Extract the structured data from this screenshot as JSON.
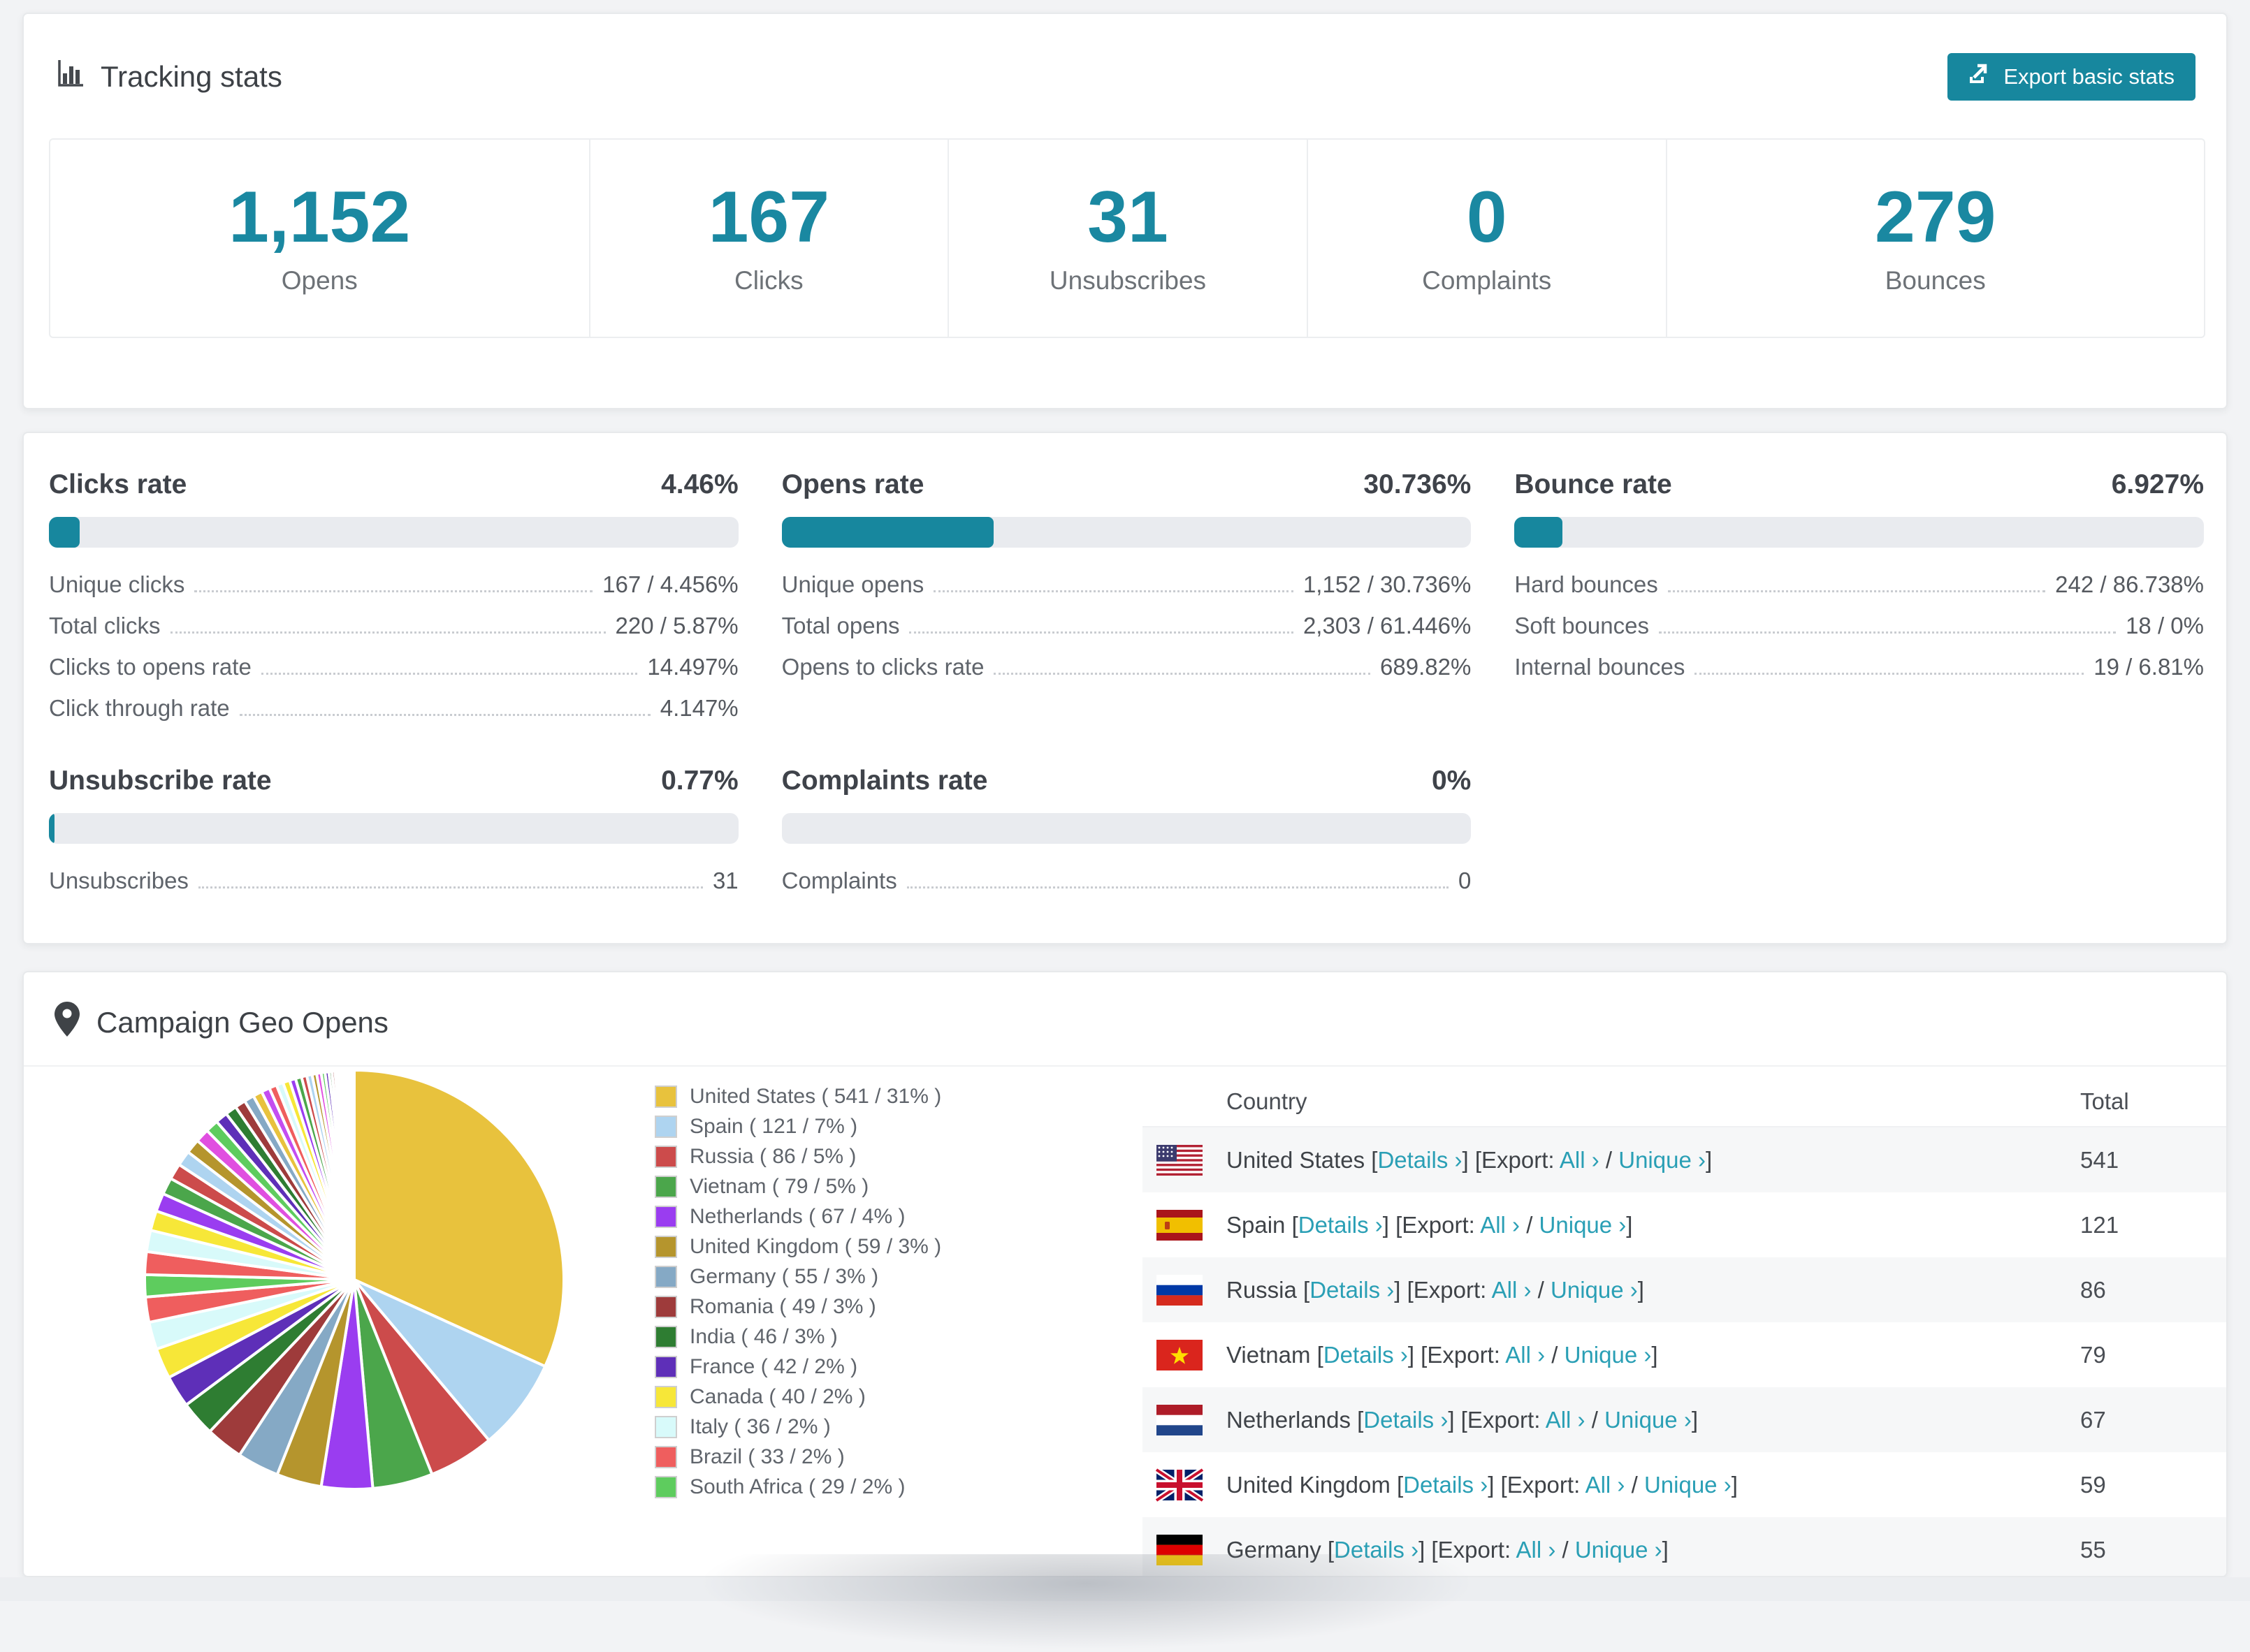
{
  "colors": {
    "accent": "#17879e",
    "stat_number": "#1a88a1",
    "link": "#2a9fb5",
    "bar_track": "#e9ebef",
    "stripe": "#f6f7f8"
  },
  "tracking": {
    "title": "Tracking stats",
    "export_label": "Export basic stats",
    "stats": [
      {
        "value": "1,152",
        "label": "Opens"
      },
      {
        "value": "167",
        "label": "Clicks"
      },
      {
        "value": "31",
        "label": "Unsubscribes"
      },
      {
        "value": "0",
        "label": "Complaints"
      },
      {
        "value": "279",
        "label": "Bounces"
      }
    ]
  },
  "rates": [
    {
      "title": "Clicks rate",
      "value": "4.46%",
      "pct": 4.46,
      "rows": [
        {
          "label": "Unique clicks",
          "value": "167 / 4.456%"
        },
        {
          "label": "Total clicks",
          "value": "220 / 5.87%"
        },
        {
          "label": "Clicks to opens rate",
          "value": "14.497%"
        },
        {
          "label": "Click through rate",
          "value": "4.147%"
        }
      ]
    },
    {
      "title": "Opens rate",
      "value": "30.736%",
      "pct": 30.736,
      "rows": [
        {
          "label": "Unique opens",
          "value": "1,152 / 30.736%"
        },
        {
          "label": "Total opens",
          "value": "2,303 / 61.446%"
        },
        {
          "label": "Opens to clicks rate",
          "value": "689.82%"
        }
      ]
    },
    {
      "title": "Bounce rate",
      "value": "6.927%",
      "pct": 6.927,
      "rows": [
        {
          "label": "Hard bounces",
          "value": "242 / 86.738%"
        },
        {
          "label": "Soft bounces",
          "value": "18 / 0%"
        },
        {
          "label": "Internal bounces",
          "value": "19 / 6.81%"
        }
      ]
    },
    {
      "title": "Unsubscribe rate",
      "value": "0.77%",
      "pct": 0.77,
      "rows": [
        {
          "label": "Unsubscribes",
          "value": "31"
        }
      ]
    },
    {
      "title": "Complaints rate",
      "value": "0%",
      "pct": 0,
      "rows": [
        {
          "label": "Complaints",
          "value": "0"
        }
      ]
    }
  ],
  "geo": {
    "title": "Campaign Geo Opens",
    "table": {
      "columns": [
        "Country",
        "Total"
      ],
      "links": {
        "open": "[",
        "close": "]",
        "details": "Details ›",
        "export": "Export:",
        "all": "All ›",
        "sep": " / ",
        "unique": "Unique ›"
      },
      "rows": [
        {
          "country": "United States",
          "total": "541",
          "flag": "us"
        },
        {
          "country": "Spain",
          "total": "121",
          "flag": "es"
        },
        {
          "country": "Russia",
          "total": "86",
          "flag": "ru"
        },
        {
          "country": "Vietnam",
          "total": "79",
          "flag": "vn"
        },
        {
          "country": "Netherlands",
          "total": "67",
          "flag": "nl"
        },
        {
          "country": "United Kingdom",
          "total": "59",
          "flag": "gb"
        },
        {
          "country": "Germany",
          "total": "55",
          "flag": "de"
        }
      ]
    }
  },
  "chart_data": {
    "type": "pie",
    "title": "Campaign Geo Opens",
    "legend_position": "right",
    "start_angle_deg": -90,
    "direction": "clockwise",
    "slices": [
      {
        "name": "United States",
        "value": 541,
        "pct": "31%",
        "color": "#e8c23d"
      },
      {
        "name": "Spain",
        "value": 121,
        "pct": "7%",
        "color": "#aed4f0"
      },
      {
        "name": "Russia",
        "value": 86,
        "pct": "5%",
        "color": "#cc4b4b"
      },
      {
        "name": "Vietnam",
        "value": 79,
        "pct": "5%",
        "color": "#4ba64b"
      },
      {
        "name": "Netherlands",
        "value": 67,
        "pct": "4%",
        "color": "#9a3df0"
      },
      {
        "name": "United Kingdom",
        "value": 59,
        "pct": "3%",
        "color": "#b5952d"
      },
      {
        "name": "Germany",
        "value": 55,
        "pct": "3%",
        "color": "#85a9c5"
      },
      {
        "name": "Romania",
        "value": 49,
        "pct": "3%",
        "color": "#9e3b3b"
      },
      {
        "name": "India",
        "value": 46,
        "pct": "3%",
        "color": "#2e7d32"
      },
      {
        "name": "France",
        "value": 42,
        "pct": "2%",
        "color": "#5e2fb8"
      },
      {
        "name": "Canada",
        "value": 40,
        "pct": "2%",
        "color": "#f7e738"
      },
      {
        "name": "Italy",
        "value": 36,
        "pct": "2%",
        "color": "#d8fafa"
      },
      {
        "name": "Brazil",
        "value": 33,
        "pct": "2%",
        "color": "#ef5e5e"
      },
      {
        "name": "South Africa",
        "value": 29,
        "pct": "2%",
        "color": "#5ecc5e"
      }
    ],
    "others": {
      "note": "unlabeled small countries, drawn as thin slices",
      "values": [
        30,
        28,
        26,
        24,
        22,
        21,
        20,
        19,
        18,
        17,
        16,
        15,
        14,
        13,
        12,
        11,
        10,
        9,
        9,
        8,
        8,
        7,
        7,
        6,
        6,
        5,
        5,
        4,
        4,
        3,
        3,
        3,
        2,
        2,
        2,
        2,
        1,
        1,
        1,
        1,
        1,
        1,
        1,
        1
      ],
      "palette": [
        "#ef5e5e",
        "#d8fafa",
        "#f7e738",
        "#9a3df0",
        "#4ba64b",
        "#cc4b4b",
        "#aed4f0",
        "#b5952d",
        "#e04fe0",
        "#5ecc5e",
        "#5e2fb8",
        "#2e7d32",
        "#9e3b3b",
        "#85a9c5",
        "#e8c23d",
        "#c44df0"
      ]
    },
    "legend_label_format": "{name} ( {value} / {pct} )"
  }
}
